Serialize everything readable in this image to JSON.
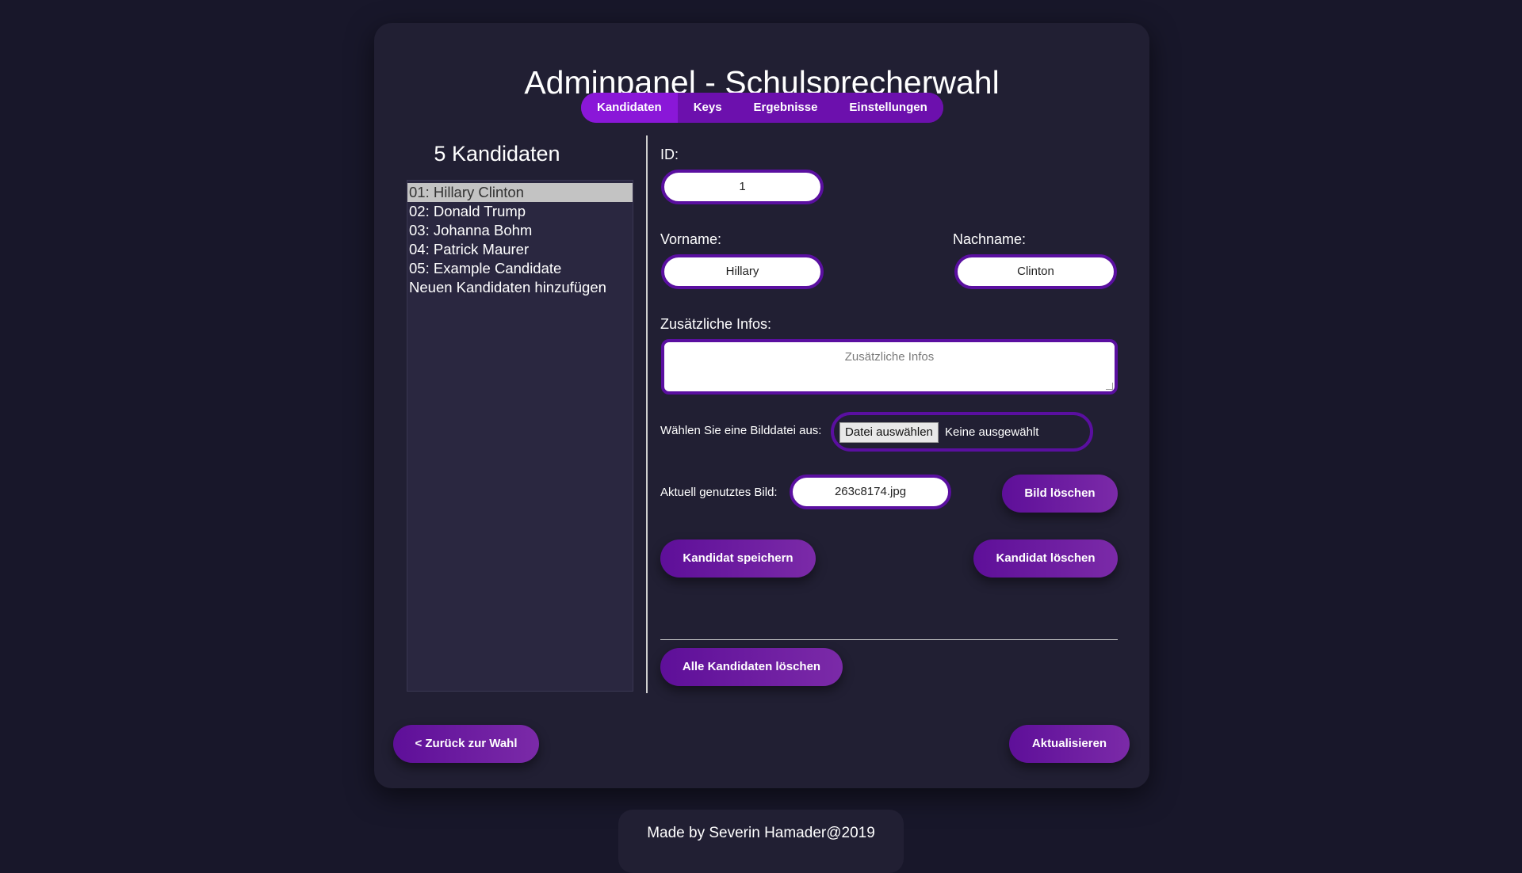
{
  "header": {
    "title": "Adminpanel - Schulsprecherwahl"
  },
  "tabs": [
    {
      "label": "Kandidaten",
      "active": true
    },
    {
      "label": "Keys",
      "active": false
    },
    {
      "label": "Ergebnisse",
      "active": false
    },
    {
      "label": "Einstellungen",
      "active": false
    }
  ],
  "candidates": {
    "count_title": "5 Kandidaten",
    "items": [
      {
        "label": "01: Hillary Clinton",
        "selected": true
      },
      {
        "label": "02: Donald Trump",
        "selected": false
      },
      {
        "label": "03: Johanna Bohm",
        "selected": false
      },
      {
        "label": "04: Patrick Maurer",
        "selected": false
      },
      {
        "label": "05: Example Candidate",
        "selected": false
      },
      {
        "label": "Neuen Kandidaten hinzufügen",
        "selected": false
      }
    ]
  },
  "form": {
    "id_label": "ID:",
    "id_value": "1",
    "firstname_label": "Vorname:",
    "firstname_value": "Hillary",
    "lastname_label": "Nachname:",
    "lastname_value": "Clinton",
    "info_label": "Zusätzliche Infos:",
    "info_placeholder": "Zusätzliche Infos",
    "file_label": "Wählen Sie eine Bilddatei aus:",
    "file_button": "Datei auswählen",
    "file_status": "Keine ausgewählt",
    "current_image_label": "Aktuell genutztes Bild:",
    "current_image_value": "263c8174.jpg",
    "delete_image_button": "Bild löschen",
    "save_button": "Kandidat speichern",
    "delete_button": "Kandidat löschen",
    "delete_all_button": "Alle Kandidaten löschen"
  },
  "nav": {
    "back_button": "< Zurück zur Wahl",
    "refresh_button": "Aktualisieren"
  },
  "footer": {
    "text": "Made by Severin Hamader@2019"
  },
  "colors": {
    "page_bg": "#18172a",
    "panel_bg": "#211f33",
    "accent": "#7d13c9",
    "accent_dark": "#5e0f99",
    "field_border": "#5a0fa0"
  }
}
